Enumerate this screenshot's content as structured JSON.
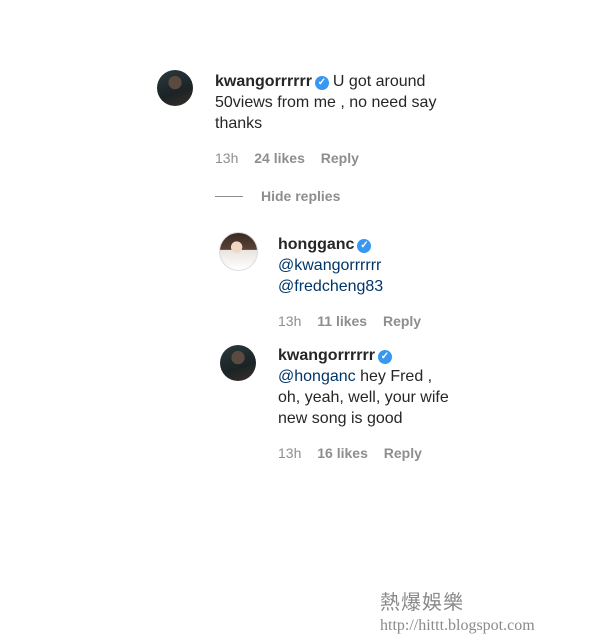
{
  "comments": [
    {
      "username": "kwangorrrrrr",
      "text_lines": [
        "U got around",
        "50views from me , no need say",
        "thanks"
      ],
      "time": "13h",
      "likes": "24 likes",
      "reply": "Reply"
    }
  ],
  "hide_replies": "Hide replies",
  "replies": [
    {
      "username": "hongganc",
      "mention1": "@kwangorrrrrr",
      "mention2": "@fredcheng83",
      "time": "13h",
      "likes": "11 likes",
      "reply": "Reply"
    },
    {
      "username": "kwangorrrrrr",
      "mention": "@honganc",
      "text_line1": " hey Fred ,",
      "text_line2": "oh, yeah, well, your wife",
      "text_line3": "new song is good",
      "time": "13h",
      "likes": "16 likes",
      "reply": "Reply"
    }
  ],
  "watermark": {
    "chinese": "熱爆娛樂",
    "url": "http://hittt.blogspot.com"
  },
  "colors": {
    "verified": "#3897f0",
    "mention": "#003569",
    "meta": "#8e8e8e"
  }
}
